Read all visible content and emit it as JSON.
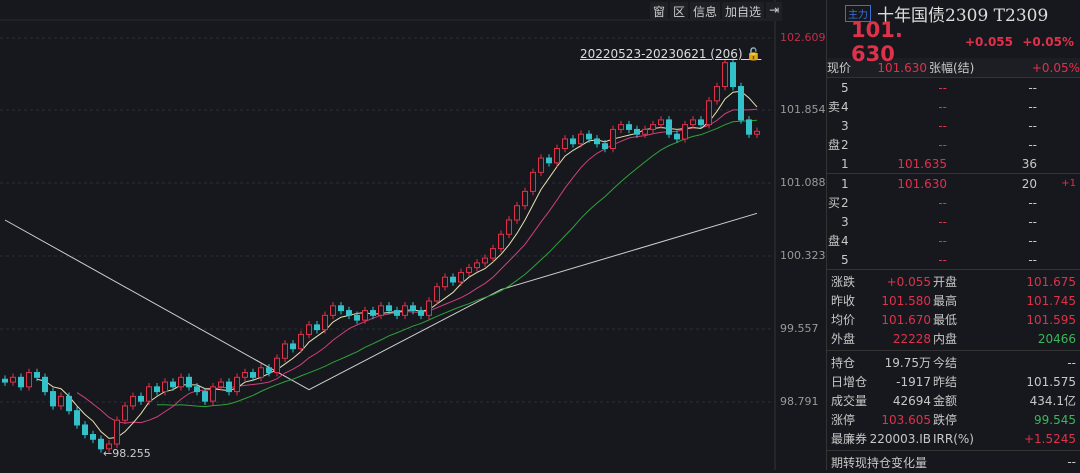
{
  "toolbar": [
    "窗",
    "区",
    "信息",
    "加自选",
    "⇥"
  ],
  "range_label": "20220523-20230621 (206)",
  "low_marker": "98.255",
  "axis_labels": [
    "102.609",
    "101.854",
    "101.088",
    "100.323",
    "99.557",
    "98.791"
  ],
  "chart_data": {
    "type": "candlestick",
    "ylim": [
      98.791,
      102.609
    ],
    "closes": [
      99.0,
      99.05,
      98.95,
      99.1,
      99.05,
      98.9,
      98.75,
      98.85,
      98.7,
      98.55,
      98.45,
      98.4,
      98.3,
      98.35,
      98.6,
      98.75,
      98.85,
      98.8,
      98.95,
      98.9,
      99.0,
      98.95,
      99.05,
      98.95,
      98.9,
      98.8,
      98.95,
      99.0,
      98.9,
      99.05,
      99.1,
      99.05,
      99.15,
      99.1,
      99.25,
      99.4,
      99.35,
      99.5,
      99.6,
      99.55,
      99.7,
      99.8,
      99.75,
      99.7,
      99.65,
      99.75,
      99.7,
      99.8,
      99.75,
      99.7,
      99.8,
      99.75,
      99.7,
      99.85,
      100.0,
      100.1,
      100.05,
      100.15,
      100.2,
      100.25,
      100.3,
      100.4,
      100.55,
      100.7,
      100.85,
      101.0,
      101.2,
      101.35,
      101.3,
      101.45,
      101.55,
      101.5,
      101.6,
      101.55,
      101.5,
      101.45,
      101.65,
      101.7,
      101.65,
      101.6,
      101.65,
      101.7,
      101.75,
      101.6,
      101.55,
      101.7,
      101.75,
      101.7,
      101.95,
      102.1,
      102.35,
      102.1,
      101.75,
      101.6,
      101.63
    ],
    "long_ma": [
      [
        0,
        100.7
      ],
      [
        38,
        98.92
      ],
      [
        62,
        99.97
      ],
      [
        94,
        100.77
      ]
    ]
  },
  "panel": {
    "tag": "主力",
    "name": "十年国债2309 T2309",
    "price": "101. 630",
    "change": "+0.055",
    "pct": "+0.05%",
    "now": {
      "l1": "现价",
      "v1": "101.630",
      "l2": "张幅(结)",
      "v2": "+0.05%"
    },
    "sell_label": [
      "卖",
      "盘"
    ],
    "buy_label": [
      "买",
      "盘"
    ],
    "asks": [
      [
        "5",
        "--",
        "--",
        ""
      ],
      [
        "4",
        "--",
        "--",
        ""
      ],
      [
        "3",
        "--",
        "--",
        ""
      ],
      [
        "2",
        "--",
        "--",
        ""
      ],
      [
        "1",
        "101.635",
        "36",
        ""
      ]
    ],
    "bids": [
      [
        "1",
        "101.630",
        "20",
        "+1"
      ],
      [
        "2",
        "--",
        "--",
        ""
      ],
      [
        "3",
        "--",
        "--",
        ""
      ],
      [
        "4",
        "--",
        "--",
        ""
      ],
      [
        "5",
        "--",
        "--",
        ""
      ]
    ],
    "stats1": [
      [
        "涨跌",
        "+0.055",
        "开盘",
        "101.675"
      ],
      [
        "昨收",
        "101.580",
        "最高",
        "101.745"
      ],
      [
        "均价",
        "101.670",
        "最低",
        "101.595"
      ],
      [
        "外盘",
        "22228",
        "内盘",
        "20466"
      ]
    ],
    "stats2": [
      [
        "持仓",
        "19.75万",
        "今结",
        "--"
      ],
      [
        "日增仓",
        "-1917",
        "昨结",
        "101.575"
      ],
      [
        "成交量",
        "42694",
        "金额",
        "434.1亿"
      ],
      [
        "涨停",
        "103.605",
        "跌停",
        "99.545"
      ],
      [
        "最廉券",
        "220003.IB",
        "IRR(%)",
        "+1.5245"
      ]
    ],
    "footer": [
      "期转现持仓变化量",
      "--"
    ]
  }
}
